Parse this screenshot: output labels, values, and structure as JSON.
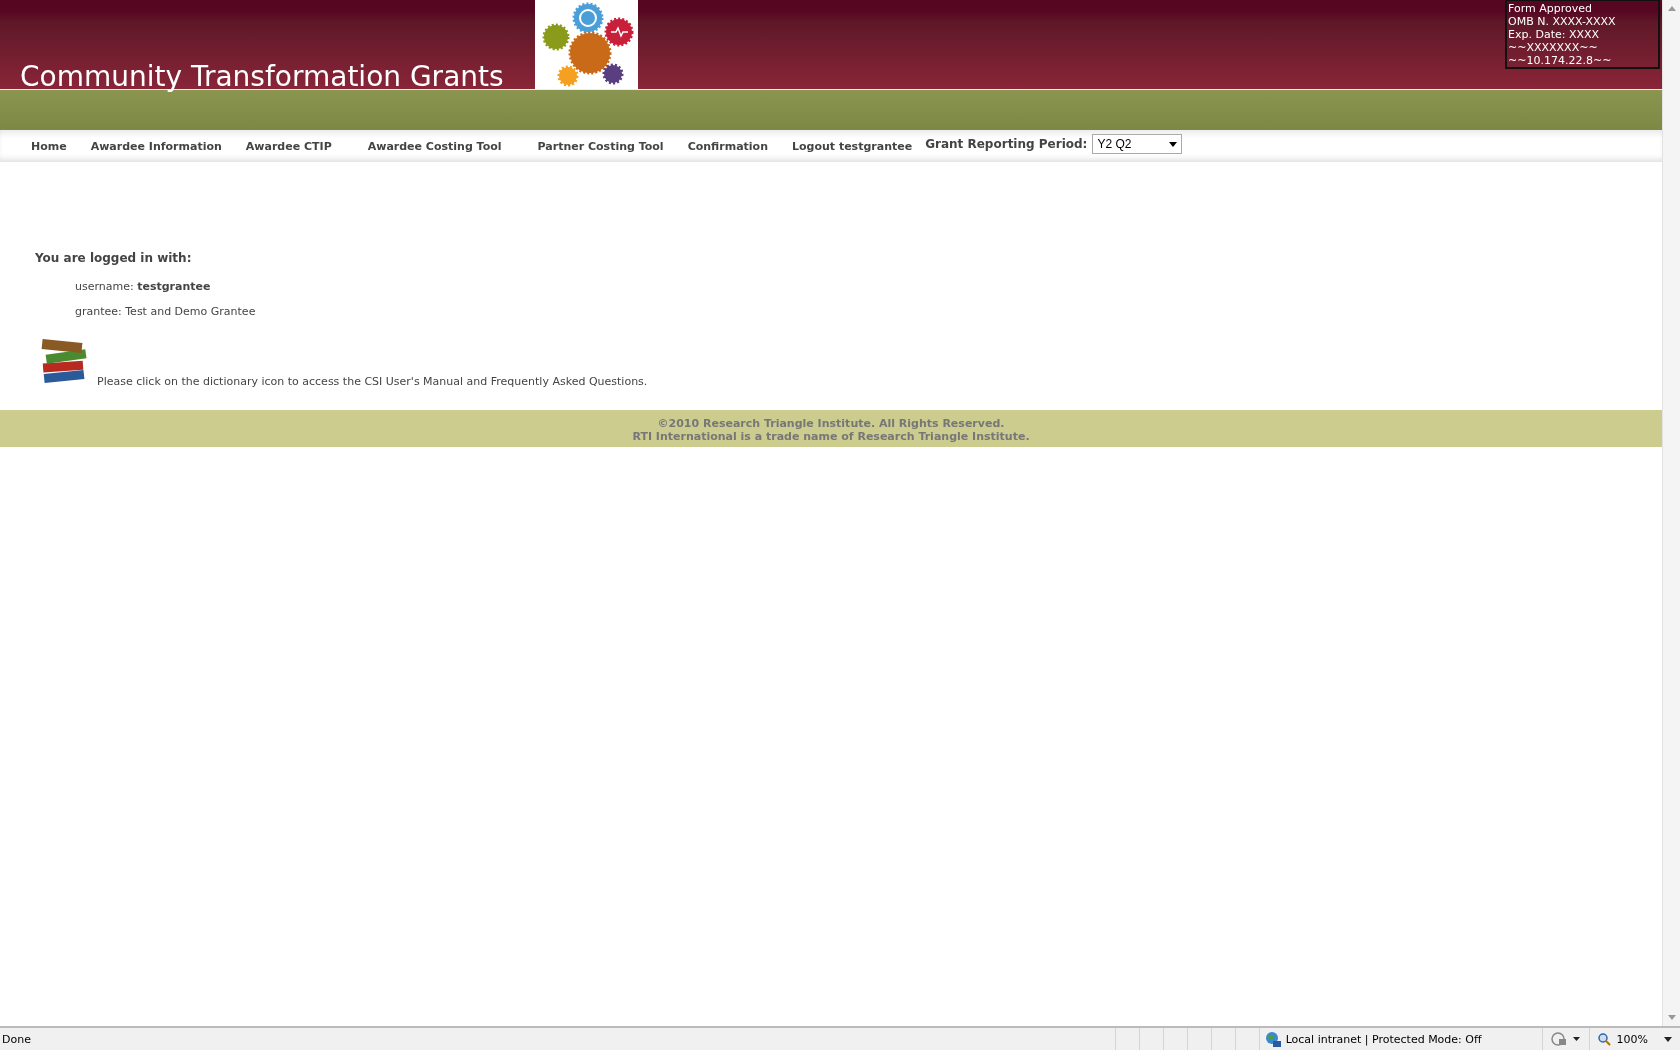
{
  "header": {
    "title": "Community Transformation Grants",
    "form_info": [
      "Form Approved",
      "OMB N. XXXX-XXXX",
      "Exp. Date: XXXX",
      "~~XXXXXXX~~",
      "~~10.174.22.8~~"
    ]
  },
  "nav": {
    "links": [
      "Home",
      "Awardee Information",
      "Awardee CTIP",
      "Awardee Costing Tool",
      "Partner Costing Tool",
      "Confirmation",
      "Logout testgrantee"
    ],
    "period_label": "Grant Reporting Period:",
    "period_value": "Y2 Q2"
  },
  "login": {
    "heading": "You are logged in with:",
    "fields": [
      "username: **testgrantee**",
      "grantee: Test and Demo Grantee"
    ]
  },
  "help_text": "Please click on the dictionary icon to access the CSI User's Manual and Frequently Asked Questions.",
  "footer": [
    "©2010 Research Triangle Institute. All Rights Reserved.",
    "RTI International is a trade name of Research Triangle Institute."
  ],
  "status_bar": {
    "status": "Done",
    "zone": "Local intranet | Protected Mode: Off",
    "zoom": "100%"
  }
}
